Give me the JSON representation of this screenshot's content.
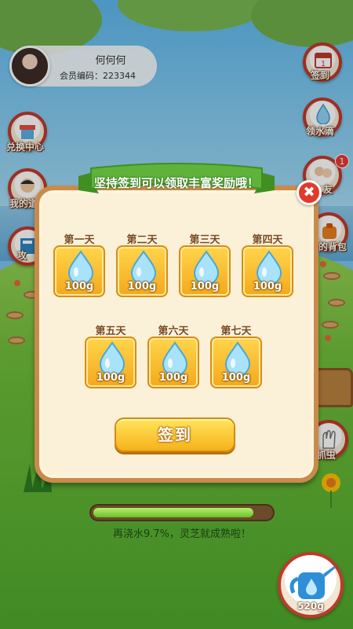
{
  "user": {
    "name": "何何何",
    "member_id": "会员编码：223344"
  },
  "side_menu": [
    {
      "key": "exchange",
      "label": "兑换中心"
    },
    {
      "key": "mine",
      "label": "我的道"
    },
    {
      "key": "strategy",
      "label": "攻"
    },
    {
      "key": "checkin",
      "label": "签到"
    },
    {
      "key": "water",
      "label": "领水滴"
    },
    {
      "key": "friends",
      "label": "友",
      "badge": "1"
    },
    {
      "key": "bag",
      "label": "的背包"
    },
    {
      "key": "bug",
      "label": "去抓虫"
    }
  ],
  "popup": {
    "banner": "坚持签到可以领取丰富奖励哦！",
    "close": "✖",
    "days": [
      {
        "label": "第一天",
        "reward": "100g"
      },
      {
        "label": "第二天",
        "reward": "100g"
      },
      {
        "label": "第三天",
        "reward": "100g"
      },
      {
        "label": "第四天",
        "reward": "100g"
      },
      {
        "label": "第五天",
        "reward": "100g"
      },
      {
        "label": "第六天",
        "reward": "100g"
      },
      {
        "label": "第七天",
        "reward": "100g"
      }
    ],
    "sign_button": "签到"
  },
  "growth": {
    "progress_percent": 90.3,
    "message": "再浇水9.7%，灵芝就成熟啦！"
  },
  "watering_can": {
    "amount": "520g"
  },
  "colors": {
    "accent_red": "#c0392b",
    "ribbon_green": "#5fb33a",
    "card_gold": "#f4a81d"
  }
}
